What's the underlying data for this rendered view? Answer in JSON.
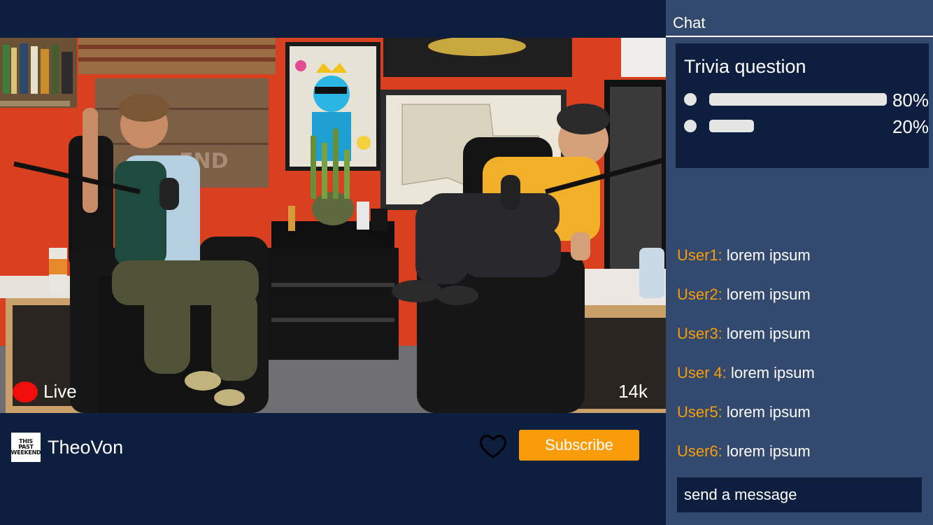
{
  "stream": {
    "live_label": "Live",
    "viewer_count": "14k",
    "channel_name": "TheoVon",
    "channel_logo_lines": [
      "THIS",
      "PAST",
      "WEEKEND"
    ],
    "subscribe_label": "Subscribe",
    "icons": {
      "heart": "heart-outline-icon",
      "live": "live-dot-icon"
    }
  },
  "chat": {
    "title": "Chat",
    "trivia": {
      "title": "Trivia question",
      "options": [
        {
          "percent_label": "80%",
          "fraction": 0.8
        },
        {
          "percent_label": "20%",
          "fraction": 0.2
        }
      ]
    },
    "messages": [
      {
        "user": "User1:",
        "text": "lorem ipsum"
      },
      {
        "user": "User2:",
        "text": "lorem ipsum"
      },
      {
        "user": "User3:",
        "text": "lorem ipsum"
      },
      {
        "user": "User 4:",
        "text": "lorem ipsum"
      },
      {
        "user": "User5:",
        "text": "lorem ipsum"
      },
      {
        "user": "User6:",
        "text": "lorem ipsum"
      }
    ],
    "input_placeholder": "send a message"
  },
  "colors": {
    "background": "#0e1e3e",
    "sidebar": "#33496d",
    "accent": "#f99c0a",
    "live_red": "#f20d0d",
    "poll_bar": "#e5e5e5"
  }
}
